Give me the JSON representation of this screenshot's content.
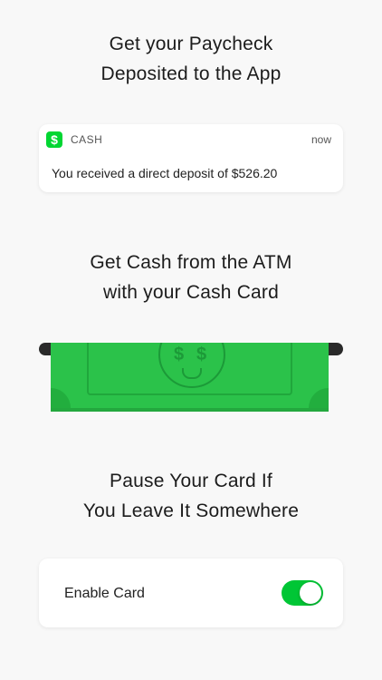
{
  "section1": {
    "title_line1": "Get your Paycheck",
    "title_line2": "Deposited to the App"
  },
  "notification": {
    "app_icon_glyph": "$",
    "app_name": "CASH",
    "time": "now",
    "message": "You received a direct deposit of $526.20"
  },
  "section2": {
    "title_line1": "Get Cash from the ATM",
    "title_line2": "with your Cash Card"
  },
  "bill": {
    "eye_glyph": "$"
  },
  "section3": {
    "title_line1": "Pause Your Card If",
    "title_line2": "You Leave It Somewhere"
  },
  "card_setting": {
    "label": "Enable Card",
    "enabled": true
  },
  "colors": {
    "accent": "#00d632",
    "toggle_on": "#00c635",
    "bill_green": "#2bc24a"
  }
}
